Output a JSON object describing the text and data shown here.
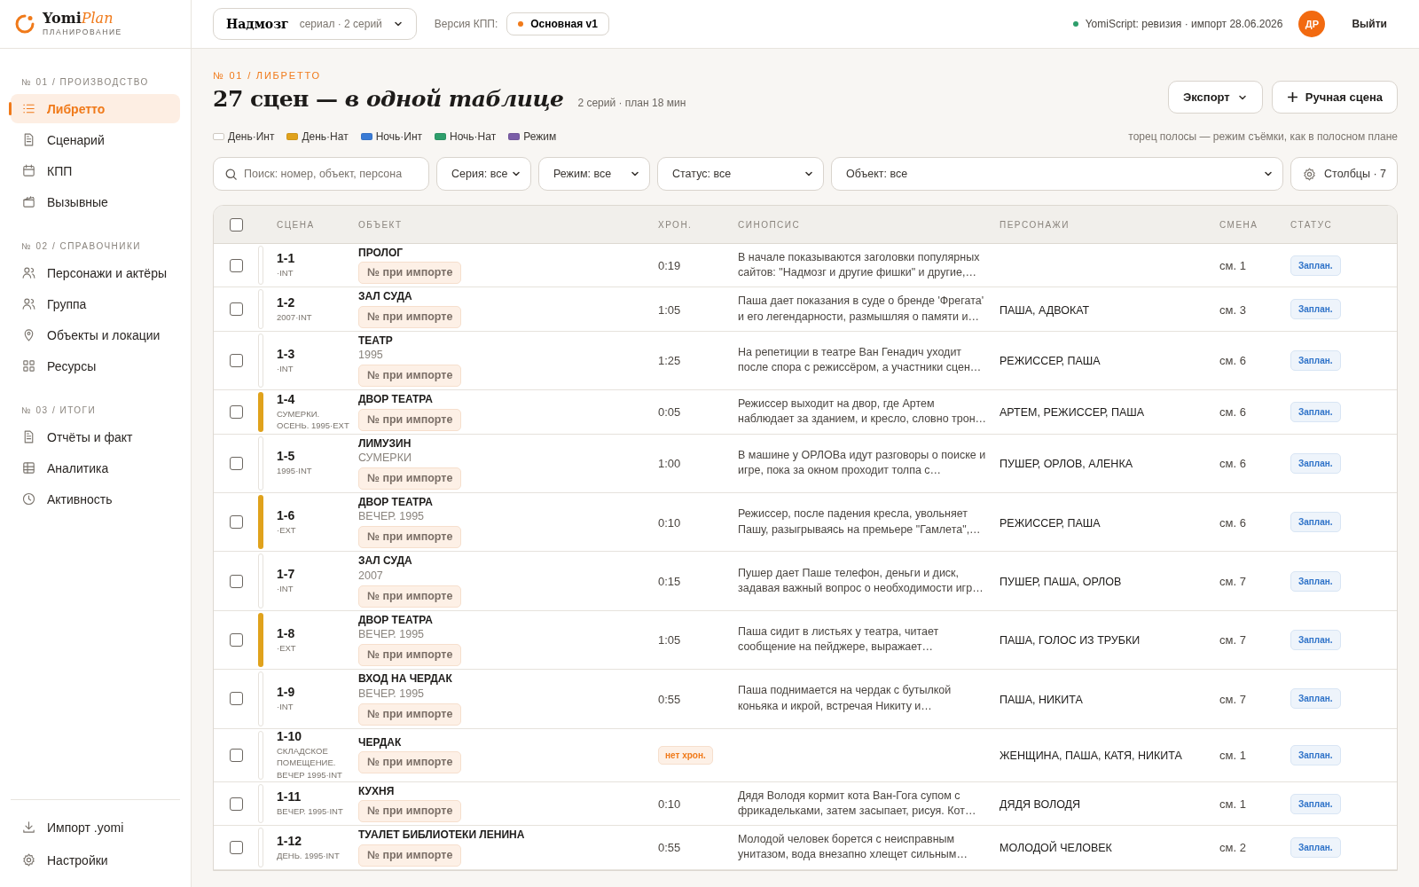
{
  "logo": {
    "name": "Yomi",
    "accent": "Plan",
    "subtitle": "ПЛАНИРОВАНИЕ"
  },
  "topbar": {
    "project": {
      "title": "Надмозг",
      "meta": "сериал · 2 серий"
    },
    "version_label": "Версия КПП:",
    "version": {
      "label": "Основная v1",
      "color": "#f07a1a"
    },
    "sync": {
      "text": "YomiScript: ревизия · импорт 28.06.2026",
      "color": "#2e9e6b"
    },
    "avatar": "ДР",
    "logout": "Выйти"
  },
  "sidebar": {
    "sections": [
      {
        "label": "№ 01 / ПРОИЗВОДСТВО",
        "items": [
          {
            "label": "Либретто",
            "selected": true
          },
          {
            "label": "Сценарий",
            "selected": false
          },
          {
            "label": "КПП",
            "selected": false
          },
          {
            "label": "Вызывные",
            "selected": false
          }
        ]
      },
      {
        "label": "№ 02 / СПРАВОЧНИКИ",
        "items": [
          {
            "label": "Персонажи и актёры",
            "selected": false
          },
          {
            "label": "Группа",
            "selected": false
          },
          {
            "label": "Объекты и локации",
            "selected": false
          },
          {
            "label": "Ресурсы",
            "selected": false
          }
        ]
      },
      {
        "label": "№ 03 / ИТОГИ",
        "items": [
          {
            "label": "Отчёты и факт",
            "selected": false
          },
          {
            "label": "Аналитика",
            "selected": false
          },
          {
            "label": "Активность",
            "selected": false
          }
        ]
      }
    ],
    "footer": [
      {
        "label": "Импорт .yomi"
      },
      {
        "label": "Настройки"
      }
    ]
  },
  "page": {
    "eyebrow": "№ 01 / ЛИБРЕТТО",
    "title": "27 сцен — *в одной таблице*",
    "meta": "2 серий · план 18 мин",
    "actions": [
      {
        "label": "Экспорт",
        "kind": "dropdown"
      },
      {
        "label": "Ручная сцена",
        "kind": "add"
      }
    ]
  },
  "legend": {
    "items": [
      {
        "label": "День·Инт",
        "color": "#ffffff"
      },
      {
        "label": "День·Нат",
        "color": "#e0a21c"
      },
      {
        "label": "Ночь·Инт",
        "color": "#3a7bd5"
      },
      {
        "label": "Ночь·Нат",
        "color": "#2e9e6b"
      },
      {
        "label": "Режим",
        "color": "#7b5ea7"
      }
    ],
    "note": "торец полосы — режим съёмки, как в полосном плане"
  },
  "filters": {
    "search": {
      "placeholder": "Поиск: номер, объект, персона"
    },
    "selects": [
      "Серия: все",
      "Режим: все",
      "Статус: все",
      "Объект: все"
    ],
    "columns_button": "Столбцы · 7"
  },
  "table": {
    "select_all": {
      "checked": false
    },
    "columns": [
      "СЦЕНА",
      "ОБЪЕКТ",
      "ХРОН.",
      "СИНОПСИС",
      "ПЕРСОНАЖИ",
      "СМЕНА",
      "СТАТУС"
    ],
    "rows": [
      {
        "checked": false,
        "color": "#ffffff",
        "scene": "1-1",
        "meta": "·INT",
        "object": "ПРОЛОГ",
        "badge": "№ при импорте",
        "duration": "0:19",
        "duration_missing": false,
        "synopsis": "В начале показываются заголовки популярных сайтов: \"Надмозг и другие фишки\" и другие,…",
        "shift": "см. 1",
        "status": "Заплан."
      },
      {
        "checked": false,
        "color": "#ffffff",
        "scene": "1-2",
        "meta": "2007·INT",
        "object": "ЗАЛ СУДА",
        "badge": "№ при импорте",
        "duration": "1:05",
        "duration_missing": false,
        "synopsis": "Паша дает показания в суде о бренде 'Фрегата' и его легендарности, размышляя о памяти и…",
        "characters": "ПАША, АДВОКАТ",
        "shift": "см. 3",
        "status": "Заплан."
      },
      {
        "checked": false,
        "color": "#ffffff",
        "scene": "1-3",
        "meta": "·INT",
        "object": "ТЕАТР",
        "object_sub": "1995",
        "badge": "№ при импорте",
        "duration": "1:25",
        "duration_missing": false,
        "synopsis": "На репетиции в театре Ван Генадич уходит после спора с режиссёром, а участники сцен…",
        "characters": "РЕЖИССЕР, ПАША",
        "shift": "см. 6",
        "status": "Заплан."
      },
      {
        "checked": false,
        "color": "#e0a21c",
        "scene": "1-4",
        "meta": "СУМЕРКИ. ОСЕНЬ. 1995·EXT",
        "object": "ДВОР ТЕАТРА",
        "badge": "№ при импорте",
        "duration": "0:05",
        "duration_missing": false,
        "synopsis": "Режиссер выходит на двор, где Артем наблюдает за зданием, и кресло, словно трон…",
        "characters": "АРТЕМ, РЕЖИССЕР, ПАША",
        "shift": "см. 6",
        "status": "Заплан."
      },
      {
        "checked": false,
        "color": "#ffffff",
        "scene": "1-5",
        "meta": "1995·INT",
        "object": "ЛИМУЗИН",
        "object_sub": "СУМЕРКИ",
        "badge": "№ при импорте",
        "duration": "1:00",
        "duration_missing": false,
        "synopsis": "В машине у ОРЛОВа идут разговоры о поиске и игре, пока за окном проходит толпа с…",
        "characters": "ПУШЕР, ОРЛОВ, АЛЕНКА",
        "shift": "см. 6",
        "status": "Заплан."
      },
      {
        "checked": false,
        "color": "#e0a21c",
        "scene": "1-6",
        "meta": "·EXT",
        "object": "ДВОР ТЕАТРА",
        "object_sub": "ВЕЧЕР. 1995",
        "badge": "№ при импорте",
        "duration": "0:10",
        "duration_missing": false,
        "synopsis": "Режиссер, после падения кресла, увольняет Пашу, разыгрываясь на премьере \"Гамлета\",…",
        "characters": "РЕЖИССЕР, ПАША",
        "shift": "см. 6",
        "status": "Заплан."
      },
      {
        "checked": false,
        "color": "#ffffff",
        "scene": "1-7",
        "meta": "·INT",
        "object": "ЗАЛ СУДА",
        "object_sub": "2007",
        "badge": "№ при импорте",
        "duration": "0:15",
        "duration_missing": false,
        "synopsis": "Пушер дает Паше телефон, деньги и диск, задавая важный вопрос о необходимости игр…",
        "characters": "ПУШЕР, ПАША, ОРЛОВ",
        "shift": "см. 7",
        "status": "Заплан."
      },
      {
        "checked": false,
        "color": "#e0a21c",
        "scene": "1-8",
        "meta": "·EXT",
        "object": "ДВОР ТЕАТРА",
        "object_sub": "ВЕЧЕР. 1995",
        "badge": "№ при импорте",
        "duration": "1:05",
        "duration_missing": false,
        "synopsis": "Паша сидит в листьях у театра, читает сообщение на пейджере, выражает…",
        "characters": "ПАША, ГОЛОС ИЗ ТРУБКИ",
        "shift": "см. 7",
        "status": "Заплан."
      },
      {
        "checked": false,
        "color": "#ffffff",
        "scene": "1-9",
        "meta": "·INT",
        "object": "ВХОД НА ЧЕРДАК",
        "object_sub": "ВЕЧЕР. 1995",
        "badge": "№ при импорте",
        "duration": "0:55",
        "duration_missing": false,
        "synopsis": "Паша поднимается на чердак с бутылкой коньяка и икрой, встречая Никиту и…",
        "characters": "ПАША, НИКИТА",
        "shift": "см. 7",
        "status": "Заплан."
      },
      {
        "checked": false,
        "color": "#ffffff",
        "scene": "1-10",
        "meta": "СКЛАДСКОЕ ПОМЕЩЕНИЕ. ВЕЧЕР 1995·INT",
        "object": "ЧЕРДАК",
        "badge": "№ при импорте",
        "duration": "нет хрон.",
        "duration_missing": true,
        "characters": "ЖЕНЩИНА, ПАША, КАТЯ, НИКИТА",
        "shift": "см. 1",
        "status": "Заплан."
      },
      {
        "checked": false,
        "color": "#ffffff",
        "scene": "1-11",
        "meta": "ВЕЧЕР. 1995·INT",
        "object": "КУХНЯ",
        "badge": "№ при импорте",
        "duration": "0:10",
        "duration_missing": false,
        "synopsis": "Дядя Володя кормит кота Ван-Гога супом с фрикадельками, затем засыпает, рисуя. Кот…",
        "characters": "ДЯДЯ ВОЛОДЯ",
        "shift": "см. 1",
        "status": "Заплан."
      },
      {
        "checked": false,
        "color": "#ffffff",
        "scene": "1-12",
        "meta": "ДЕНЬ. 1995·INT",
        "object": "ТУАЛЕТ БИБЛИОТЕКИ ЛЕНИНА",
        "badge": "№ при импорте",
        "duration": "0:55",
        "duration_missing": false,
        "synopsis": "Молодой человек борется с неисправным унитазом, вода внезапно хлещет сильным…",
        "characters": "МОЛОДОЙ ЧЕЛОВЕК",
        "shift": "см. 2",
        "status": "Заплан."
      }
    ]
  }
}
